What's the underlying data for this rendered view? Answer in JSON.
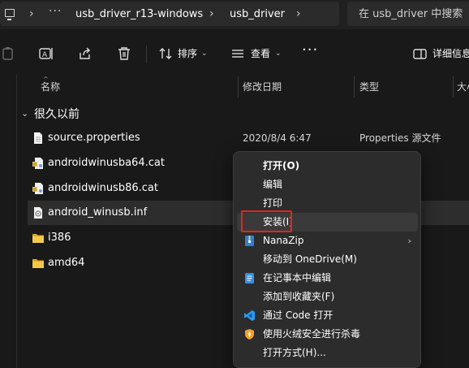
{
  "breadcrumb": {
    "more": "···",
    "items": [
      "usb_driver_r13-windows",
      "usb_driver"
    ]
  },
  "search": {
    "placeholder": "在 usb_driver 中搜索"
  },
  "toolbar": {
    "sort_label": "排序",
    "view_label": "查看",
    "more_label": "···",
    "details_label": "详细信息"
  },
  "columns": {
    "name": "名称",
    "date": "修改日期",
    "type": "类型",
    "size": "大小"
  },
  "group": {
    "label": "很久以前"
  },
  "files": [
    {
      "name": "source.properties",
      "date": "2020/8/4 6:47",
      "type": "Properties 源文件",
      "icon": "document-icon"
    },
    {
      "name": "androidwinusba64.cat",
      "date": "",
      "type": "",
      "icon": "security-catalog-icon"
    },
    {
      "name": "androidwinusb86.cat",
      "date": "",
      "type": "",
      "icon": "security-catalog-icon"
    },
    {
      "name": "android_winusb.inf",
      "date": "",
      "type": "",
      "icon": "setup-info-icon",
      "selected": true
    },
    {
      "name": "i386",
      "date": "",
      "type": "",
      "icon": "folder-icon"
    },
    {
      "name": "amd64",
      "date": "",
      "type": "",
      "icon": "folder-icon"
    }
  ],
  "context_menu": {
    "items": [
      {
        "label": "打开(O)",
        "bold": true
      },
      {
        "label": "编辑"
      },
      {
        "label": "打印"
      },
      {
        "label": "安装(I)",
        "highlighted": true
      },
      {
        "label": "NanaZip",
        "icon": "nanazip-icon",
        "submenu": true
      },
      {
        "label": "移动到 OneDrive(M)"
      },
      {
        "label": "在记事本中编辑",
        "icon": "notepad-icon"
      },
      {
        "label": "添加到收藏夹(F)"
      },
      {
        "label": "通过 Code 打开",
        "icon": "vscode-icon"
      },
      {
        "label": "使用火绒安全进行杀毒",
        "icon": "huorong-shield-icon"
      },
      {
        "label": "打开方式(H)..."
      }
    ]
  },
  "colors": {
    "background": "#191919",
    "highlight_border": "#e5251b",
    "folder": "#f0c14b"
  }
}
